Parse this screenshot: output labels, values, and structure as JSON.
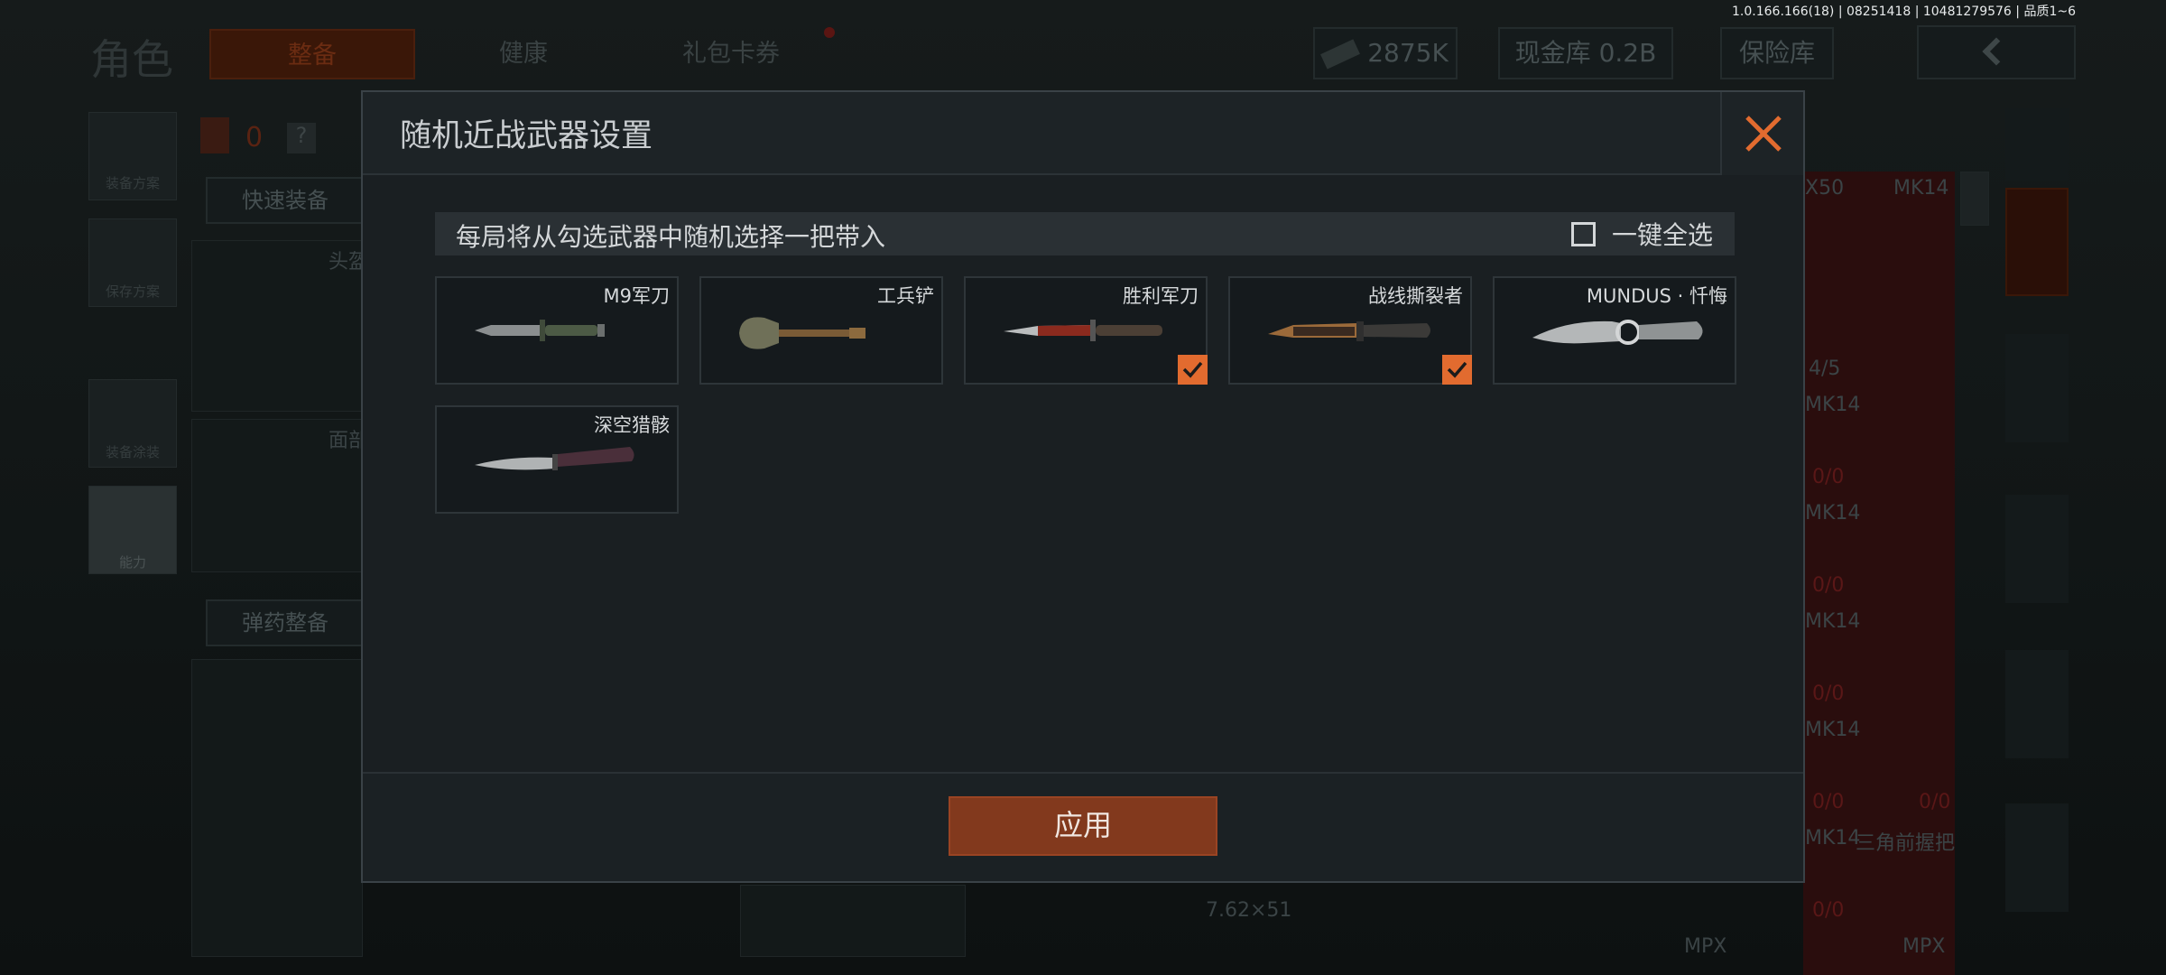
{
  "version_text": "1.0.166.166(18) | 08251418 | 10481279576 | 品质1~6",
  "background": {
    "title": "角色",
    "tabs": [
      "整备",
      "健康",
      "礼包卡券"
    ],
    "currency_value": "2875K",
    "cash_vault": "现金库 0.2B",
    "safe_box": "保险库",
    "armor_count": "0",
    "help": "?",
    "quick_equip": "快速装备",
    "ammo_equip": "弹药整备",
    "head_label": "头盔",
    "face_label": "面部",
    "left_rail": [
      "装备方案",
      "保存方案",
      "装备涂装",
      "能力"
    ],
    "caliber": "7.62×51",
    "slot_labels": [
      "X50",
      "MK14",
      "MK14",
      "MK14",
      "MK14",
      "MK14",
      "MK14",
      "三角前握把",
      "MPX",
      "MPX"
    ],
    "counts": [
      "4/5",
      "0/0",
      "0/0",
      "0/0",
      "0/0",
      "0/0",
      "0/0"
    ]
  },
  "modal": {
    "title": "随机近战武器设置",
    "info": "每局将从勾选武器中随机选择一把带入",
    "select_all": "一键全选",
    "apply": "应用",
    "accent": "#e26b2f",
    "weapons": [
      {
        "name": "M9军刀",
        "checked": false,
        "icon": "bayonet-knife-icon"
      },
      {
        "name": "工兵铲",
        "checked": false,
        "icon": "shovel-icon"
      },
      {
        "name": "胜利军刀",
        "checked": true,
        "icon": "victory-knife-icon"
      },
      {
        "name": "战线撕裂者",
        "checked": true,
        "icon": "front-ripper-knife-icon"
      },
      {
        "name": "MUNDUS · 忏悔",
        "checked": false,
        "icon": "ornate-knife-icon"
      },
      {
        "name": "深空猎骸",
        "checked": false,
        "icon": "butterfly-knife-icon"
      }
    ]
  }
}
